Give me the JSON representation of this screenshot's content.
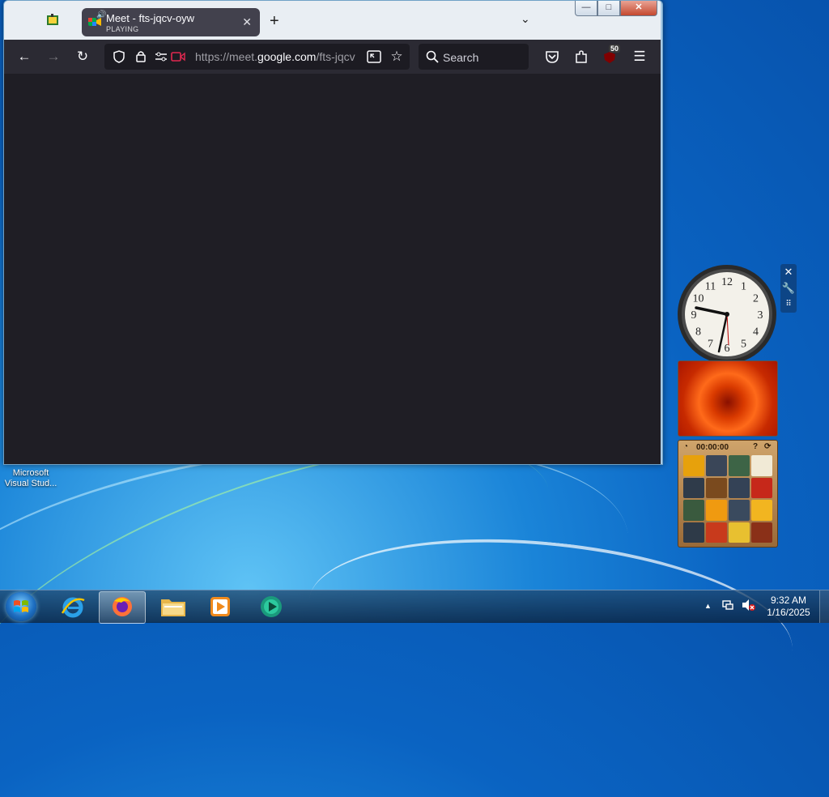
{
  "window": {
    "tab": {
      "title": "Meet - fts-jqcv-oyw",
      "status": "PLAYING"
    },
    "url": {
      "prefix": "https://meet.",
      "host": "google.com",
      "path": "/fts-jqcv"
    },
    "search_placeholder": "Search",
    "extensions_badge": "50"
  },
  "desktop": {
    "icon_label_line1": "Microsoft",
    "icon_label_line2": "Visual Stud..."
  },
  "gadgets": {
    "clock_numbers": [
      "12",
      "1",
      "2",
      "3",
      "4",
      "5",
      "6",
      "7",
      "8",
      "9",
      "10",
      "11"
    ],
    "puzzle_timer": "00:00:00"
  },
  "taskbar": {
    "time": "9:32 AM",
    "date": "1/16/2025"
  },
  "colors": {
    "toolbar": "#2b2a33",
    "content": "#1f1e25",
    "tab_active": "#42414d"
  }
}
